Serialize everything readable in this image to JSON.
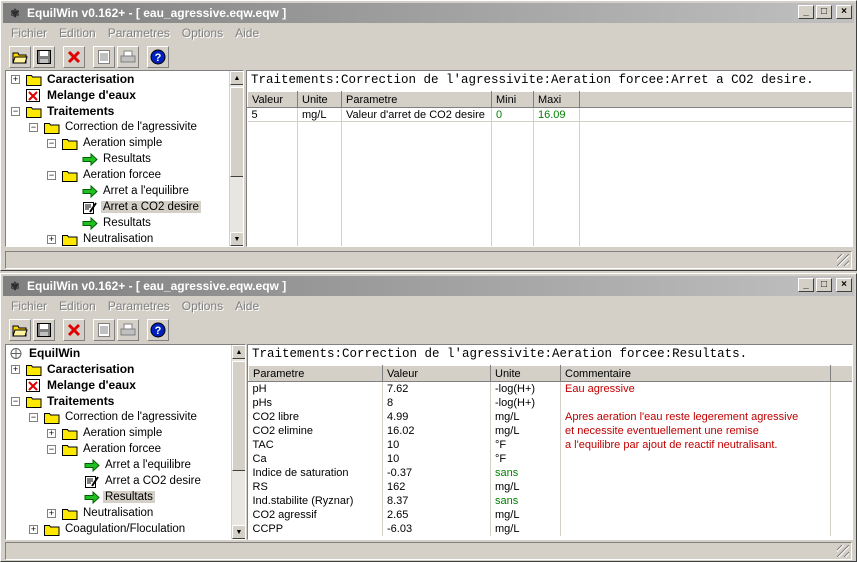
{
  "window_title": "EquilWin v0.162+ - [ eau_agressive.eqw.eqw ]",
  "menu": [
    "Fichier",
    "Edition",
    "Parametres",
    "Options",
    "Aide"
  ],
  "window1": {
    "tree": {
      "caracterisation": "Caracterisation",
      "melange": "Melange d'eaux",
      "traitements": "Traitements",
      "correction": "Correction de l'agressivite",
      "aeration_simple": "Aeration simple",
      "resultats_simple": "Resultats",
      "aeration_forcee": "Aeration forcee",
      "arret_equilibre": "Arret a l'equilibre",
      "arret_co2": "Arret a CO2 desire",
      "resultats_forcee": "Resultats",
      "neutralisation": "Neutralisation"
    },
    "path": "Traitements:Correction de l'agressivite:Aeration forcee:Arret a CO2 desire.",
    "columns": [
      "Valeur",
      "Unite",
      "Parametre",
      "Mini",
      "Maxi"
    ],
    "row": {
      "valeur": "5",
      "unite": "mg/L",
      "parametre": "Valeur d'arret de CO2 desire",
      "mini": "0",
      "maxi": "16.09"
    }
  },
  "window2": {
    "tree": {
      "root": "EquilWin",
      "caracterisation": "Caracterisation",
      "melange": "Melange d'eaux",
      "traitements": "Traitements",
      "correction": "Correction de l'agressivite",
      "aeration_simple": "Aeration simple",
      "aeration_forcee": "Aeration forcee",
      "arret_equilibre": "Arret a l'equilibre",
      "arret_co2": "Arret a CO2 desire",
      "resultats": "Resultats",
      "neutralisation": "Neutralisation",
      "coagulation": "Coagulation/Floculation"
    },
    "path": "Traitements:Correction de l'agressivite:Aeration forcee:Resultats.",
    "columns": [
      "Parametre",
      "Valeur",
      "Unite",
      "Commentaire"
    ],
    "rows": [
      {
        "p": "pH",
        "v": "7.62",
        "u": "-log(H+)",
        "c": "Eau agressive"
      },
      {
        "p": "pHs",
        "v": "8",
        "u": "-log(H+)",
        "c": ""
      },
      {
        "p": "CO2 libre",
        "v": "4.99",
        "u": "mg/L",
        "c": "Apres aeration l'eau reste legerement agressive"
      },
      {
        "p": "CO2 elimine",
        "v": "16.02",
        "u": "mg/L",
        "c": "et necessite eventuellement une remise"
      },
      {
        "p": "TAC",
        "v": "10",
        "u": "°F",
        "c": "a l'equilibre par ajout de reactif neutralisant."
      },
      {
        "p": "Ca",
        "v": "10",
        "u": "°F",
        "c": ""
      },
      {
        "p": "Indice de saturation",
        "v": "-0.37",
        "u": "sans",
        "c": ""
      },
      {
        "p": "RS",
        "v": "162",
        "u": "mg/L",
        "c": ""
      },
      {
        "p": "Ind.stabilite (Ryznar)",
        "v": "8.37",
        "u": "sans",
        "c": ""
      },
      {
        "p": "CO2 agressif",
        "v": "2.65",
        "u": "mg/L",
        "c": ""
      },
      {
        "p": "CCPP",
        "v": "-6.03",
        "u": "mg/L",
        "c": ""
      }
    ]
  },
  "colors": {
    "green": "#008000",
    "red": "#c00000",
    "titlebar": "#808080"
  },
  "icons": [
    "open-folder-icon",
    "save-icon",
    "delete-icon",
    "document-icon",
    "print-icon",
    "help-icon",
    "folder-icon",
    "arrow-right-icon",
    "edit-icon"
  ]
}
